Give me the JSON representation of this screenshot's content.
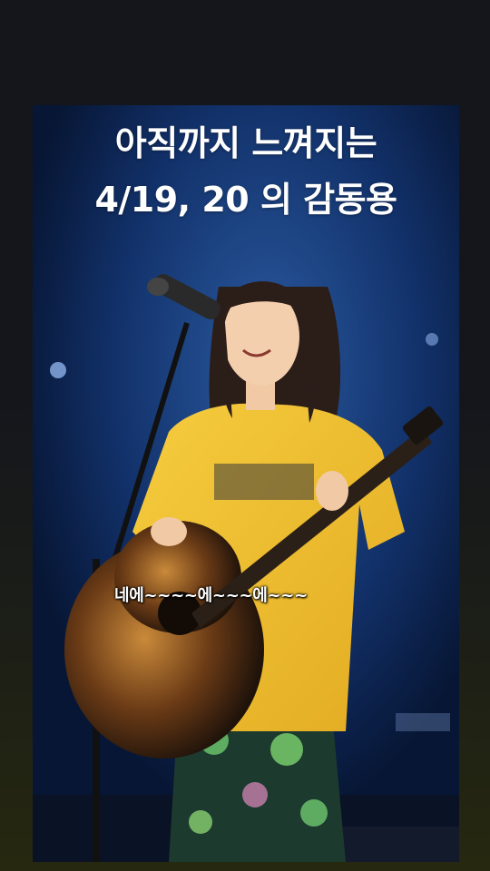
{
  "story": {
    "caption_line1": "아직까지 느껴지는",
    "caption_line2": "4/19, 20 의 감동용",
    "subtitle": "네에~~~~에~~~에~~~"
  },
  "photo": {
    "subject": "singer-with-acoustic-guitar",
    "colors": {
      "stage_background": "#0f2757",
      "shirt": "#f0c232",
      "guitar_body": "#2a1a10",
      "skirt": "#1c3a2e"
    }
  }
}
